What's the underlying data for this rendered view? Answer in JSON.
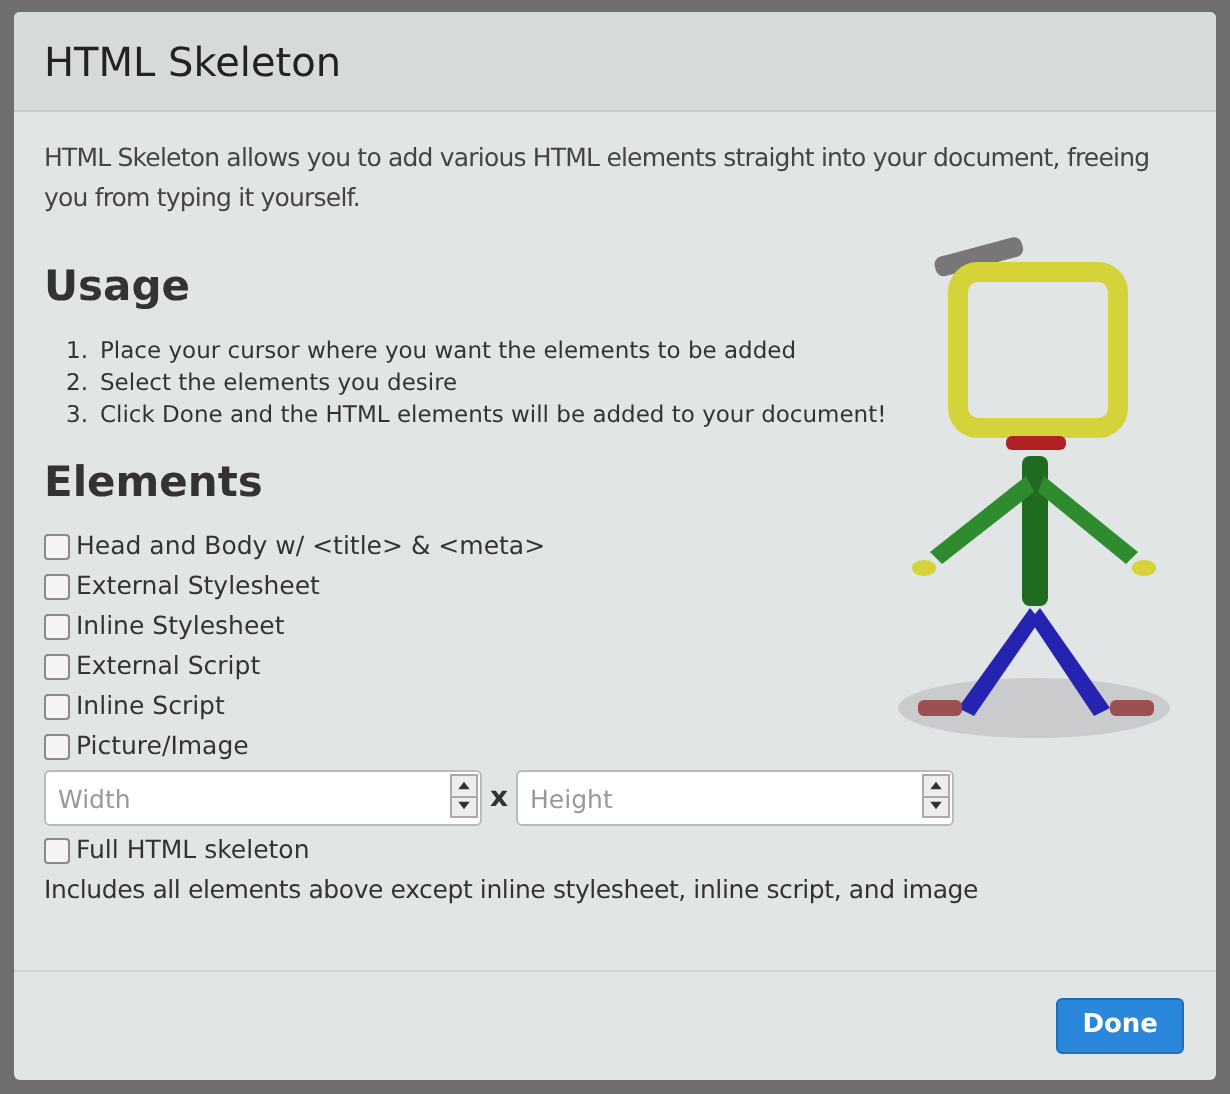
{
  "dialog": {
    "title": "HTML Skeleton"
  },
  "intro": "HTML Skeleton allows you to add various HTML elements straight into your document, freeing you from typing it yourself.",
  "usage": {
    "heading": "Usage",
    "steps": [
      {
        "number": "1.",
        "text": "Place your cursor where you want the elements to be added"
      },
      {
        "number": "2.",
        "text": "Select the elements you desire"
      },
      {
        "number": "3.",
        "text": "Click Done and the HTML elements will be added to your document!"
      }
    ]
  },
  "elements": {
    "heading": "Elements",
    "options": [
      {
        "kind": "checkbox",
        "label": "Head and Body w/ <title> & <meta>",
        "checked": false
      },
      {
        "kind": "checkbox",
        "label": "External Stylesheet",
        "checked": false
      },
      {
        "kind": "checkbox",
        "label": "Inline Stylesheet",
        "checked": false
      },
      {
        "kind": "checkbox",
        "label": "External Script",
        "checked": false
      },
      {
        "kind": "checkbox",
        "label": "Inline Script",
        "checked": false
      },
      {
        "kind": "checkbox",
        "label": "Picture/Image",
        "checked": false
      },
      {
        "kind": "size",
        "width_placeholder": "Width",
        "separator": "x",
        "height_placeholder": "Height"
      },
      {
        "kind": "checkbox",
        "label": "Full HTML skeleton",
        "checked": false
      },
      {
        "kind": "note",
        "text": "Includes all elements above except inline stylesheet, inline script, and image"
      }
    ]
  },
  "buttons": [
    {
      "label": "Done"
    }
  ]
}
